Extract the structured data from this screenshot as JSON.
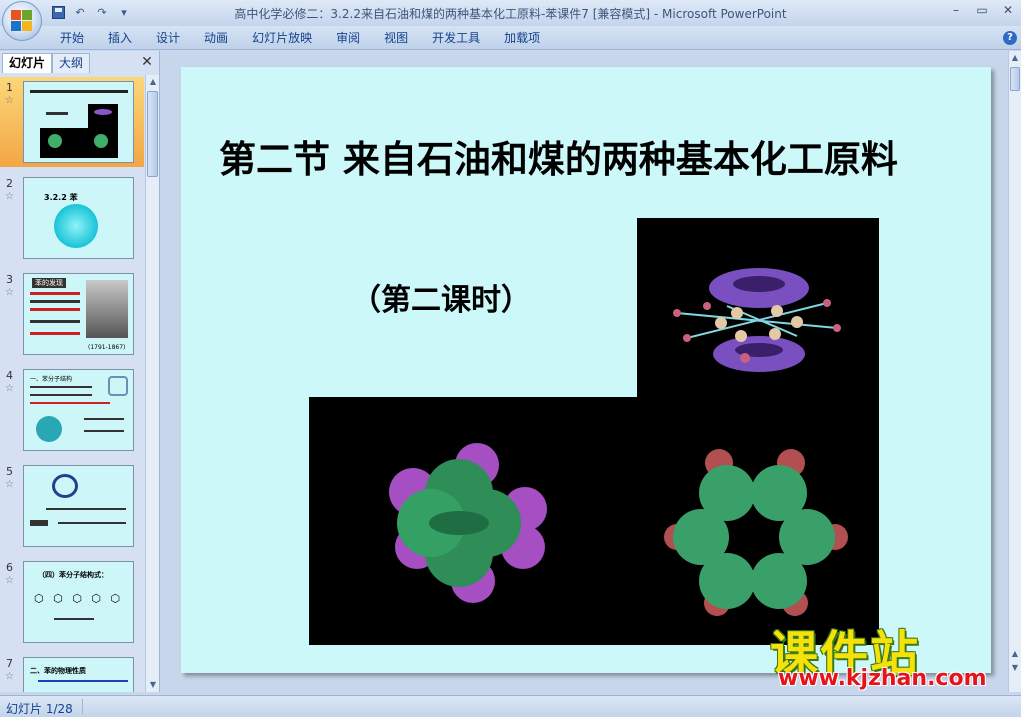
{
  "window": {
    "title": "高中化学必修二：3.2.2来自石油和煤的两种基本化工原料-苯课件7 [兼容模式] - Microsoft PowerPoint",
    "controls": {
      "minimize": "–",
      "maximize": "▭",
      "close": "✕"
    }
  },
  "qat": {
    "undo": "↶",
    "redo": "↷",
    "more": "▾"
  },
  "ribbon": {
    "tabs": [
      "开始",
      "插入",
      "设计",
      "动画",
      "幻灯片放映",
      "审阅",
      "视图",
      "开发工具",
      "加载项"
    ],
    "help": "?"
  },
  "panel": {
    "tabs": {
      "slides": "幻灯片",
      "outline": "大纲"
    },
    "close": "✕",
    "selected_slide": 1,
    "thumbnails": [
      {
        "num": "1",
        "star": "☆"
      },
      {
        "num": "2",
        "star": "☆",
        "label": "3.2.2 苯"
      },
      {
        "num": "3",
        "star": "☆",
        "label": "苯的发现",
        "caption": "(1791-1867)"
      },
      {
        "num": "4",
        "star": "☆",
        "label": "一、苯分子结构"
      },
      {
        "num": "5",
        "star": "☆"
      },
      {
        "num": "6",
        "star": "☆",
        "label": "（四）苯分子结构式："
      },
      {
        "num": "7",
        "star": "☆",
        "label": "二、苯的物理性质"
      }
    ]
  },
  "slide": {
    "title": "第二节 来自石油和煤的两种基本化工原料",
    "subtitle": "（第二课时）"
  },
  "watermark": {
    "brand": "课件站",
    "url": "www.kjzhan.com"
  },
  "status": {
    "slide_indicator": "幻灯片 1/28"
  },
  "colors": {
    "slide_bg": "#ccf8f9",
    "selected_thumb": "#f3a644",
    "ribbon_text": "#15428b"
  }
}
